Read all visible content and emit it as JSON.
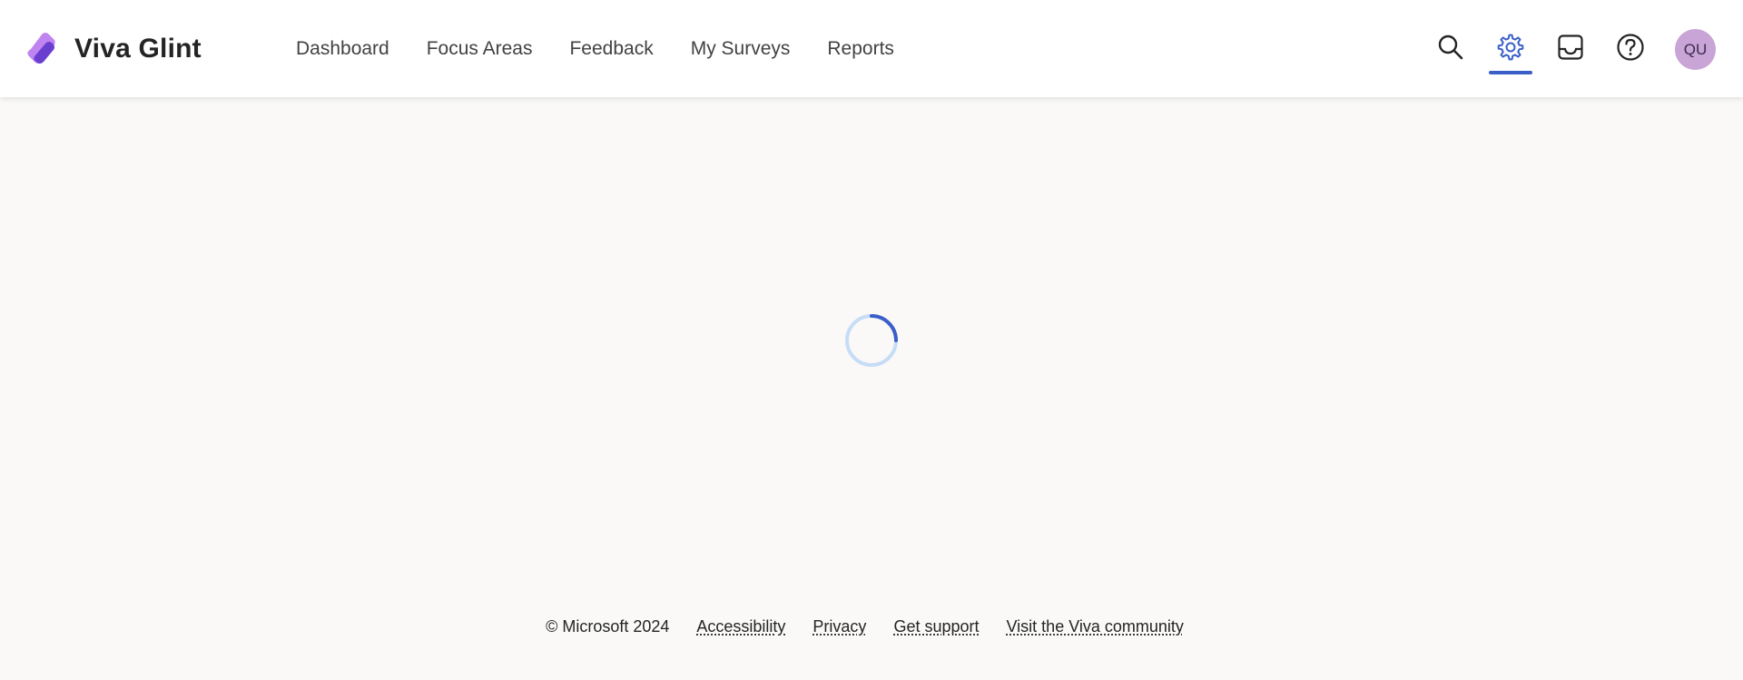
{
  "app": {
    "name": "Viva Glint"
  },
  "nav": {
    "items": [
      {
        "label": "Dashboard"
      },
      {
        "label": "Focus Areas"
      },
      {
        "label": "Feedback"
      },
      {
        "label": "My Surveys"
      },
      {
        "label": "Reports"
      }
    ]
  },
  "actions": {
    "search_icon": "search-icon",
    "settings_icon": "gear-icon",
    "inbox_icon": "inbox-icon",
    "help_icon": "help-icon",
    "active": "settings",
    "avatar_initials": "QU"
  },
  "main": {
    "state": "loading"
  },
  "footer": {
    "copyright": "© Microsoft 2024",
    "links": [
      {
        "label": "Accessibility"
      },
      {
        "label": "Privacy"
      },
      {
        "label": "Get support"
      },
      {
        "label": "Visit the Viva community"
      }
    ]
  },
  "colors": {
    "accent": "#3a5fc8",
    "spinner_track": "#c7dcf6",
    "avatar_bg": "#c9a4d6",
    "logo_primary": "#7c4ddb",
    "logo_secondary": "#c084f0"
  }
}
